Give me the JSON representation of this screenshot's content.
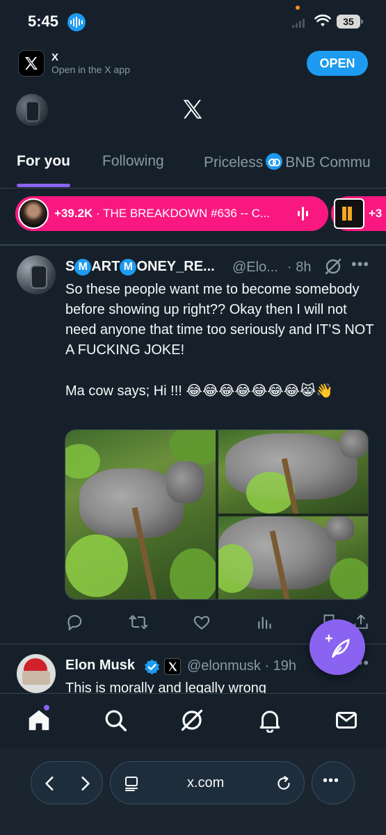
{
  "status_bar": {
    "time": "5:45",
    "battery": "35"
  },
  "app_banner": {
    "app_name": "X",
    "subtitle": "Open in the X app",
    "open_label": "OPEN"
  },
  "tabs": [
    {
      "label": "For you",
      "active": true
    },
    {
      "label": "Following",
      "active": false
    },
    {
      "label": "Priceless",
      "suffix": "BNB Commu",
      "active": false
    }
  ],
  "spaces": [
    {
      "count": "+39.2K",
      "title": " · THE BREAKDOWN #636 -- C..."
    },
    {
      "count": "+3"
    }
  ],
  "tweets": [
    {
      "display_name": "SⓂARTⓂONEY_RE...",
      "name_parts": [
        "S",
        "M",
        "ART",
        "M",
        "ONEY_RE..."
      ],
      "handle": "@Elo...",
      "time": "· 8h",
      "text_1": "So these people want me to become somebody before showing up right?? Okay then I will not need anyone that time too seriously and IT’S NOT A FUCKING JOKE!",
      "text_2": "Ma cow says; Hi !!! ",
      "emojis": "😂😂😂😂😂😂😂😹👋",
      "media_count": 3
    },
    {
      "display_name": "Elon Musk",
      "handle": "@elonmusk · 19h",
      "text": "This is morally and legally wrong",
      "verified": true
    }
  ],
  "browser": {
    "url": "x.com"
  },
  "colors": {
    "background": "#15202b",
    "accent": "#8a63f0",
    "link_blue": "#1d9bf0",
    "spaces_pink": "#f91880"
  },
  "icons": {
    "tweet_actions": [
      "reply-icon",
      "retweet-icon",
      "like-icon",
      "views-icon",
      "bookmark-icon",
      "share-icon"
    ],
    "bottom_nav": [
      "home-icon",
      "search-icon",
      "grok-icon",
      "notifications-icon",
      "messages-icon"
    ]
  }
}
